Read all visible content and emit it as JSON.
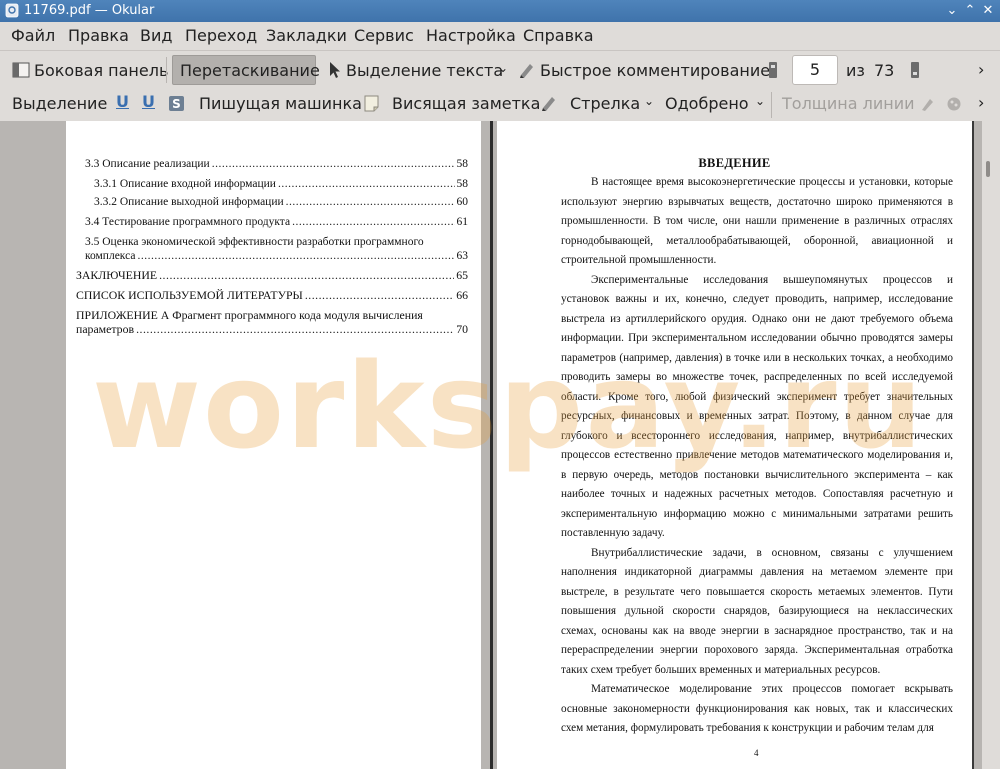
{
  "window": {
    "title": "11769.pdf  — Okular"
  },
  "menu": [
    "Файл",
    "Правка",
    "Вид",
    "Переход",
    "Закладки",
    "Сервис",
    "Настройка",
    "Справка"
  ],
  "toolbar1": {
    "sidebar": "Боковая панель",
    "drag": "Перетаскивание",
    "text_select": "Выделение текста",
    "quick_comment": "Быстрое комментирование",
    "page_current": "5",
    "page_of": "из",
    "page_total": "73"
  },
  "toolbar2": {
    "highlight": "Выделение",
    "typewriter": "Пишущая машинка",
    "note": "Висящая заметка",
    "arrow": "Стрелка",
    "stamp": "Одобрено",
    "line_width": "Толщина линии"
  },
  "toc": [
    {
      "text": "3.3 Описание реализации",
      "page": "58"
    },
    {
      "text": "3.3.1 Описание входной информации",
      "page": "58"
    },
    {
      "text": "3.3.2 Описание выходной информации",
      "page": "60"
    },
    {
      "text": "3.4 Тестирование программного продукта",
      "page": "61"
    },
    {
      "line1": "3.5  Оценка  экономической  эффективности  разработки  программного",
      "text": "комплекса",
      "page": "63"
    },
    {
      "text": "ЗАКЛЮЧЕНИЕ",
      "page": "65"
    },
    {
      "text": "СПИСОК ИСПОЛЬЗУЕМОЙ ЛИТЕРАТУРЫ",
      "page": "66"
    },
    {
      "line1": "ПРИЛОЖЕНИЕ  А  Фрагмент  программного  кода  модуля  вычисления",
      "text": "параметров",
      "page": "70"
    }
  ],
  "intro": {
    "heading": "ВВЕДЕНИЕ",
    "p1": "В настоящее время высокоэнергетические процессы и установки, которые используют энергию взрывчатых веществ, достаточно широко применяются в промышленности. В том числе, они нашли применение в различных отраслях горнодобывающей, металлообрабатывающей, оборонной, авиационной и строительной промышленности.",
    "p2": "Экспериментальные исследования вышеупомянутых процессов и установок важны и их, конечно, следует проводить, например, исследование выстрела из артиллерийского орудия. Однако они не дают требуемого объема информации. При экспериментальном исследовании обычно проводятся замеры параметров (например, давления) в точке или в нескольких точках, а необходимо проводить замеры во множестве точек, распределенных по всей исследуемой области. Кроме того, любой физический эксперимент требует значительных ресурсных, финансовых и временных затрат. Поэтому, в данном случае для глубокого и всестороннего исследования, например, внутрибаллистических процессов естественно привлечение методов математического моделирования и, в первую очередь, методов постановки вычислительного эксперимента – как наиболее точных и надежных расчетных методов. Сопоставляя расчетную и экспериментальную информацию можно с минимальными затратами решить поставленную задачу.",
    "p3": "Внутрибаллистические задачи, в основном, связаны с улучшением наполнения индикаторной диаграммы давления на метаемом элементе при выстреле, в результате чего  повышается скорость метаемых элементов. Пути повышения дульной скорости снарядов, базирующиеся на неклассических схемах, основаны как на вводе энергии в заснарядное пространство, так и на перераспределении энергии порохового заряда. Экспериментальная отработка таких схем требует больших временных и материальных ресурсов.",
    "p4": "Математическое моделирование этих процессов помогает вскрывать основные закономерности функционирования как новых, так и классических схем метания, формулировать требования к конструкции и рабочим телам для"
  },
  "page_number": "4",
  "watermark": "workspay.ru"
}
